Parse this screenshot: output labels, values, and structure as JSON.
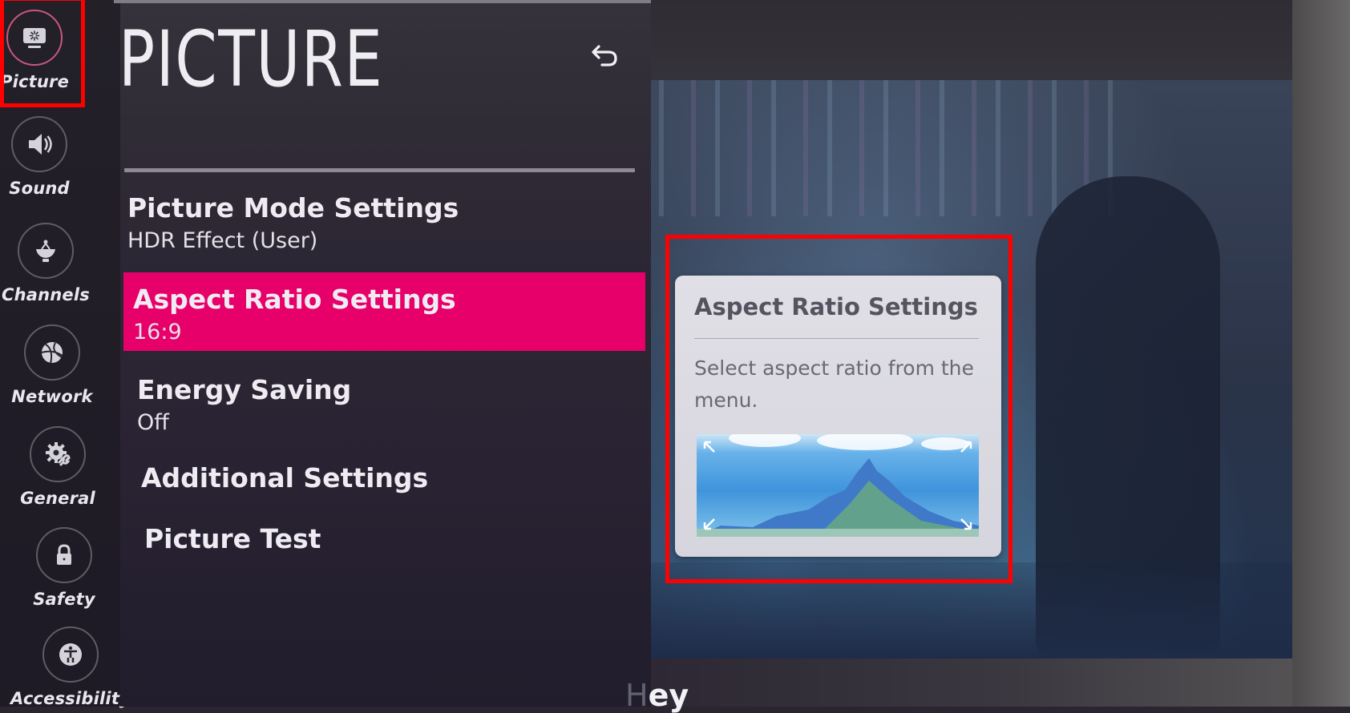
{
  "header": {
    "title": "PICTURE",
    "back_icon": "back-arrow-icon"
  },
  "sidebar": {
    "items": [
      {
        "label": "Picture",
        "icon": "picture-monitor-icon",
        "active": true
      },
      {
        "label": "Sound",
        "icon": "speaker-icon",
        "active": false
      },
      {
        "label": "Channels",
        "icon": "satellite-dish-icon",
        "active": false
      },
      {
        "label": "Network",
        "icon": "globe-network-icon",
        "active": false
      },
      {
        "label": "General",
        "icon": "gear-wrench-icon",
        "active": false
      },
      {
        "label": "Safety",
        "icon": "lock-icon",
        "active": false
      },
      {
        "label": "Accessibility",
        "icon": "accessibility-person-icon",
        "active": false
      }
    ]
  },
  "menu": {
    "items": [
      {
        "title": "Picture Mode Settings",
        "value": "HDR Effect (User)",
        "selected": false
      },
      {
        "title": "Aspect Ratio Settings",
        "value": "16:9",
        "selected": true
      },
      {
        "title": "Energy Saving",
        "value": "Off",
        "selected": false
      },
      {
        "title": "Additional Settings",
        "value": null,
        "selected": false
      },
      {
        "title": "Picture Test",
        "value": null,
        "selected": false
      }
    ]
  },
  "info_panel": {
    "title": "Aspect Ratio Settings",
    "description": "Select aspect ratio from the menu.",
    "image": "mountain-landscape-preview"
  },
  "overlay_text": {
    "dim": "H",
    "bright": "ey"
  },
  "colors": {
    "accent": "#e8006a",
    "annotation": "#ff0000",
    "active_ring": "#c9577d"
  }
}
